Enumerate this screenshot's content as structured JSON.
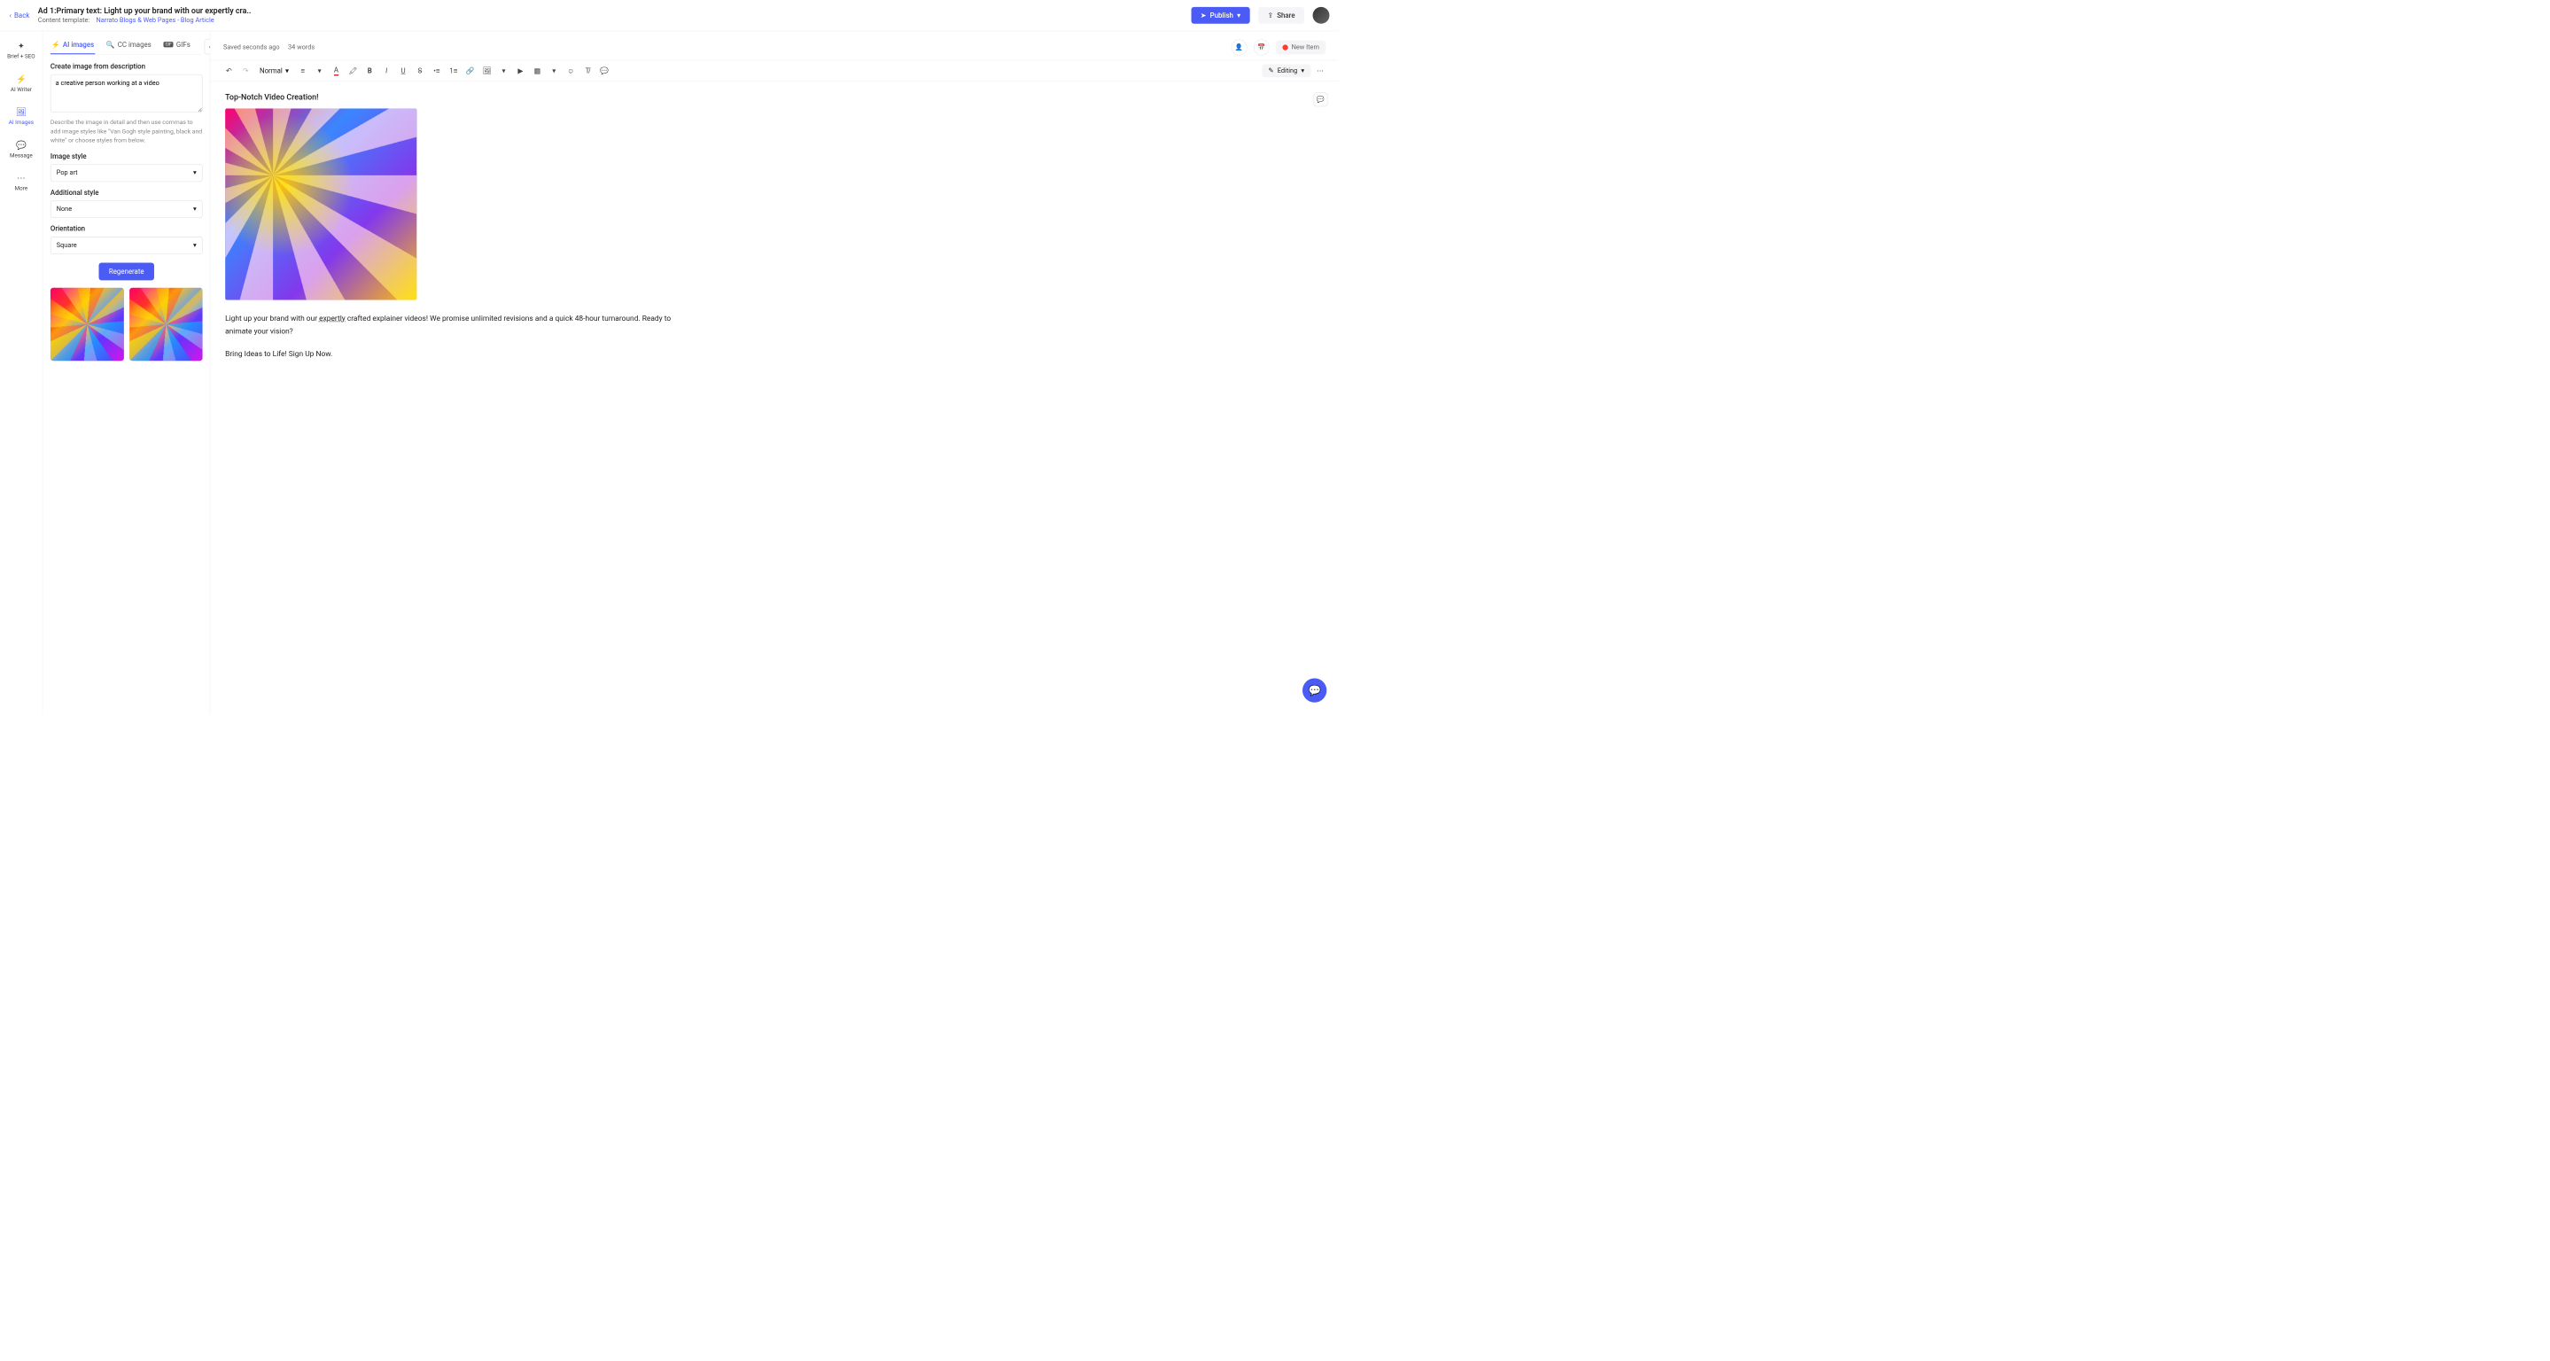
{
  "header": {
    "back": "Back",
    "title": "Ad 1:Primary text: Light up your brand with our expertly cra..",
    "subtitle_label": "Content template:",
    "subtitle_link": "Narrato Blogs & Web Pages - Blog Article",
    "publish": "Publish",
    "share": "Share"
  },
  "rail": {
    "items": [
      {
        "label": "Brief + SEO",
        "icon": "✦"
      },
      {
        "label": "AI Writer",
        "icon": "⚡"
      },
      {
        "label": "AI Images",
        "icon": "🖼"
      },
      {
        "label": "Message",
        "icon": "💬"
      },
      {
        "label": "More",
        "icon": "⋯"
      }
    ],
    "active_index": 2
  },
  "panel": {
    "tabs": {
      "ai_images": "AI images",
      "cc_images": "CC images",
      "gifs": "GIFs",
      "active": "ai_images"
    },
    "create_label": "Create image from description",
    "prompt_value": "a creative person working at a video",
    "help": "Describe the image in detail and then use commas to add image styles like \"Van Gogh style painting, black and white\" or choose styles from below.",
    "image_style_label": "Image style",
    "image_style_value": "Pop art",
    "additional_style_label": "Additional style",
    "additional_style_value": "None",
    "orientation_label": "Orientation",
    "orientation_value": "Square",
    "regenerate": "Regenerate"
  },
  "meta": {
    "saved": "Saved seconds ago",
    "words": "34 words",
    "status": "New Item"
  },
  "toolbar": {
    "style_select": "Normal",
    "mode": "Editing"
  },
  "doc": {
    "heading": "Top-Notch Video Creation!",
    "p1_a": "Light up your brand with our ",
    "p1_expertly": "expertly",
    "p1_b": " crafted explainer videos! We promise unlimited revisions and a quick 48-hour turnaround. Ready to animate your vision?",
    "p2": "Bring Ideas to Life! Sign Up Now."
  }
}
